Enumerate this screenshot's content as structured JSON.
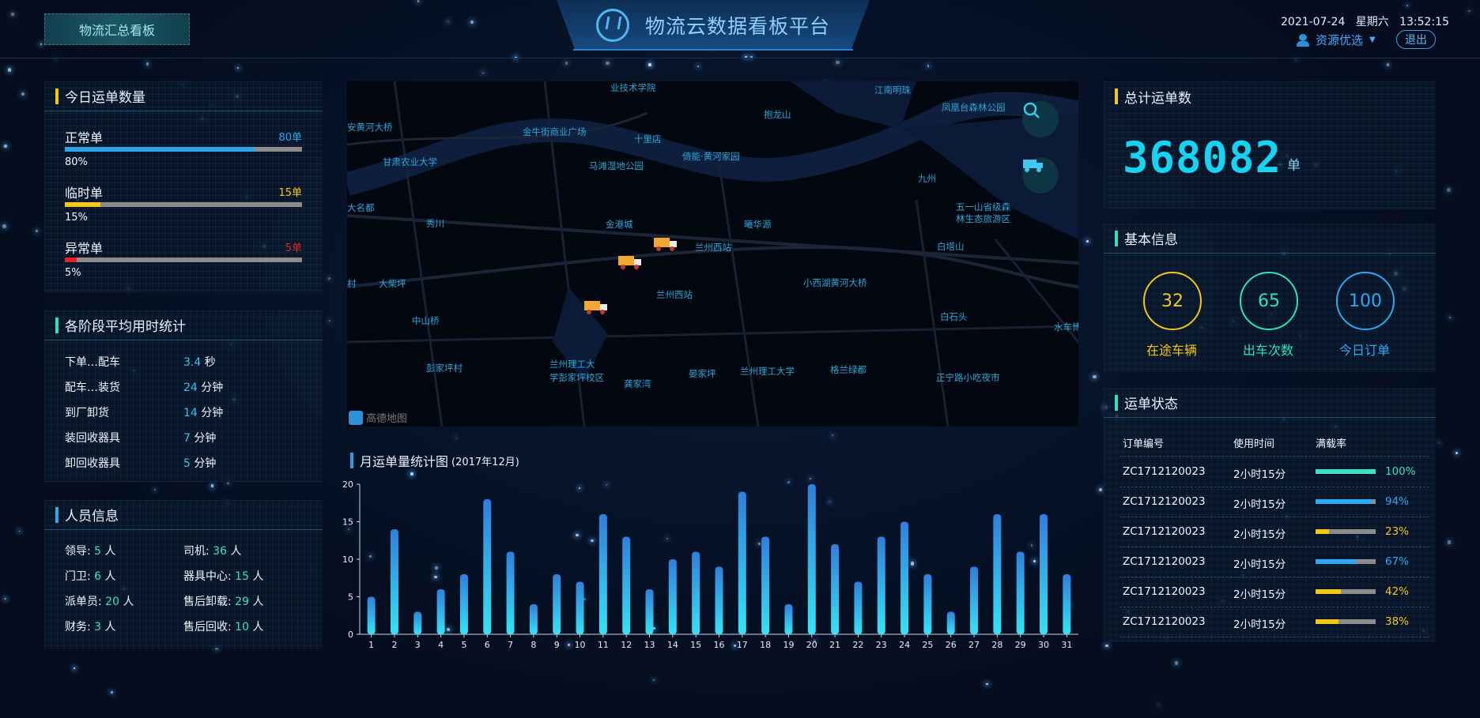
{
  "header": {
    "summary_button": "物流汇总看板",
    "title": "物流云数据看板平台",
    "date": "2021-07-24",
    "weekday": "星期六",
    "time": "13:52:15",
    "user_name": "资源优选",
    "logout": "退出"
  },
  "today_orders": {
    "title": "今日运单数量",
    "items": [
      {
        "label": "正常单",
        "count": "80单",
        "percent_text": "80%",
        "fraction": 0.8,
        "color": "#2da4ea"
      },
      {
        "label": "临时单",
        "count": "15单",
        "percent_text": "15%",
        "fraction": 0.15,
        "color": "#f7c51c"
      },
      {
        "label": "异常单",
        "count": "5单",
        "percent_text": "5%",
        "fraction": 0.05,
        "color": "#e02424"
      }
    ]
  },
  "stage_time": {
    "title": "各阶段平均用时统计",
    "items": [
      {
        "label": "下单…配车",
        "value": "3.4",
        "unit": "秒"
      },
      {
        "label": "配车…装货",
        "value": "24",
        "unit": "分钟"
      },
      {
        "label": "到厂卸货",
        "value": "14",
        "unit": "分钟"
      },
      {
        "label": "装回收器具",
        "value": "7",
        "unit": "分钟"
      },
      {
        "label": "卸回收器具",
        "value": "5",
        "unit": "分钟"
      }
    ]
  },
  "staff": {
    "title": "人员信息",
    "items": [
      {
        "label": "领导:",
        "value": "5",
        "unit": "人"
      },
      {
        "label": "司机:",
        "value": "36",
        "unit": "人"
      },
      {
        "label": "门卫:",
        "value": "6",
        "unit": "人"
      },
      {
        "label": "器具中心:",
        "value": "15",
        "unit": "人"
      },
      {
        "label": "派单员:",
        "value": "20",
        "unit": "人"
      },
      {
        "label": "售后卸载:",
        "value": "29",
        "unit": "人"
      },
      {
        "label": "财务:",
        "value": "3",
        "unit": "人"
      },
      {
        "label": "售后回收:",
        "value": "10",
        "unit": "人"
      }
    ]
  },
  "map": {
    "places": [
      "业技术学院",
      "江南明珠",
      "抱龙山",
      "凤凰台森林公园",
      "安黄河大桥",
      "金牛街商业广场",
      "十里店",
      "甘肃农业大学",
      "马滩湿地公园",
      "倚能·黄河家园",
      "九州",
      "五一山省级森",
      "林生态旅游区",
      "大名都",
      "秀川",
      "金港城",
      "曦华源",
      "白塔山",
      "兰州西站",
      "小西湖黄河大桥",
      "大柴坪",
      "兰州西站",
      "白石头",
      "中山桥",
      "水车博",
      "彭家坪村",
      "兰州理工大",
      "学彭家坪校区",
      "龚家湾",
      "晏家坪",
      "兰州理工大学",
      "格兰绿都",
      "正宁路小吃夜市",
      "村"
    ],
    "attribution": "高德地图",
    "icons": [
      "search-icon",
      "truck-icon"
    ]
  },
  "monthly_chart": {
    "title": "月运单量统计图",
    "subtitle": "(2017年12月)"
  },
  "chart_data": {
    "type": "bar",
    "title": "月运单量统计图",
    "subtitle": "(2017年12月)",
    "categories": [
      "1",
      "2",
      "3",
      "4",
      "5",
      "6",
      "7",
      "8",
      "9",
      "10",
      "11",
      "12",
      "13",
      "14",
      "15",
      "16",
      "17",
      "18",
      "19",
      "20",
      "21",
      "22",
      "23",
      "24",
      "25",
      "26",
      "27",
      "28",
      "29",
      "30",
      "31"
    ],
    "values": [
      5,
      14,
      3,
      6,
      8,
      18,
      11,
      4,
      8,
      7,
      16,
      13,
      6,
      10,
      11,
      9,
      19,
      13,
      4,
      20,
      12,
      7,
      13,
      15,
      8,
      3,
      9,
      16,
      11,
      16,
      8
    ],
    "ylim": [
      0,
      20
    ],
    "yticks": [
      0,
      5,
      10,
      15,
      20
    ],
    "color_top": "#2f7fdc",
    "color_bottom": "#34e3f6"
  },
  "total_orders": {
    "title": "总计运单数",
    "value": "368082",
    "unit": "单"
  },
  "basic_info": {
    "title": "基本信息",
    "items": [
      {
        "value": "32",
        "label": "在途车辆",
        "color": "#f5c518"
      },
      {
        "value": "65",
        "label": "出车次数",
        "color": "#2fe0c0"
      },
      {
        "value": "100",
        "label": "今日订单",
        "color": "#2ea8f0"
      }
    ]
  },
  "order_status": {
    "title": "运单状态",
    "headers": [
      "订单编号",
      "使用时间",
      "满载率"
    ],
    "rows": [
      {
        "id": "ZC1712120023",
        "time": "2小时15分",
        "rate": "100%",
        "fraction": 1.0,
        "color": "#3fe0c2"
      },
      {
        "id": "ZC1712120023",
        "time": "2小时15分",
        "rate": "94%",
        "fraction": 0.94,
        "color": "#2ea8f0"
      },
      {
        "id": "ZC1712120023",
        "time": "2小时15分",
        "rate": "23%",
        "fraction": 0.23,
        "color": "#f5c518"
      },
      {
        "id": "ZC1712120023",
        "time": "2小时15分",
        "rate": "67%",
        "fraction": 0.67,
        "color": "#2ea8f0"
      },
      {
        "id": "ZC1712120023",
        "time": "2小时15分",
        "rate": "42%",
        "fraction": 0.42,
        "color": "#f5c518"
      },
      {
        "id": "ZC1712120023",
        "time": "2小时15分",
        "rate": "38%",
        "fraction": 0.38,
        "color": "#f5c518"
      }
    ]
  }
}
